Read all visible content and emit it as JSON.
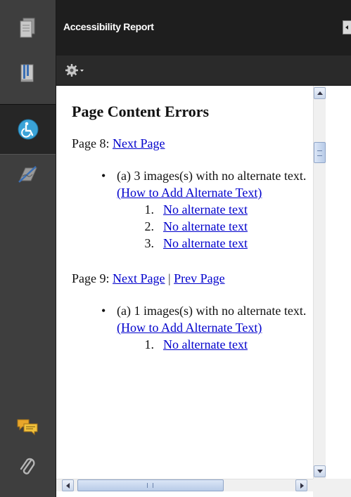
{
  "rail": {
    "items": [
      {
        "name": "pages-icon"
      },
      {
        "name": "bookmarks-icon"
      },
      {
        "name": "accessibility-icon",
        "active": true
      },
      {
        "name": "signatures-icon"
      },
      {
        "name": "comments-icon"
      },
      {
        "name": "attachments-icon"
      }
    ]
  },
  "panel": {
    "title": "Accessibility Report",
    "options_icon": "gear-icon"
  },
  "report": {
    "heading": "Page Content Errors",
    "pages": [
      {
        "label": "Page 8:",
        "links": [
          "Next Page"
        ],
        "errors": [
          {
            "text": "(a) 3 images(s) with no alternate text.",
            "help_link": "(How to Add Alternate Text)",
            "items": [
              {
                "num": "1.",
                "link": "No alternate text"
              },
              {
                "num": "2.",
                "link": "No alternate text"
              },
              {
                "num": "3.",
                "link": "No alternate text"
              }
            ]
          }
        ]
      },
      {
        "label": "Page 9:",
        "links": [
          "Next Page",
          "Prev Page"
        ],
        "separator": "|",
        "errors": [
          {
            "text": "(a) 1 images(s) with no alternate text.",
            "help_link": "(How to Add Alternate Text)",
            "items": [
              {
                "num": "1.",
                "link": "No alternate text"
              }
            ]
          }
        ]
      }
    ]
  },
  "colors": {
    "rail_bg": "#3e3e3e",
    "header_bg": "#1e1e1e",
    "link": "#0000cc",
    "accessibility_accent": "#3aa3d8"
  }
}
